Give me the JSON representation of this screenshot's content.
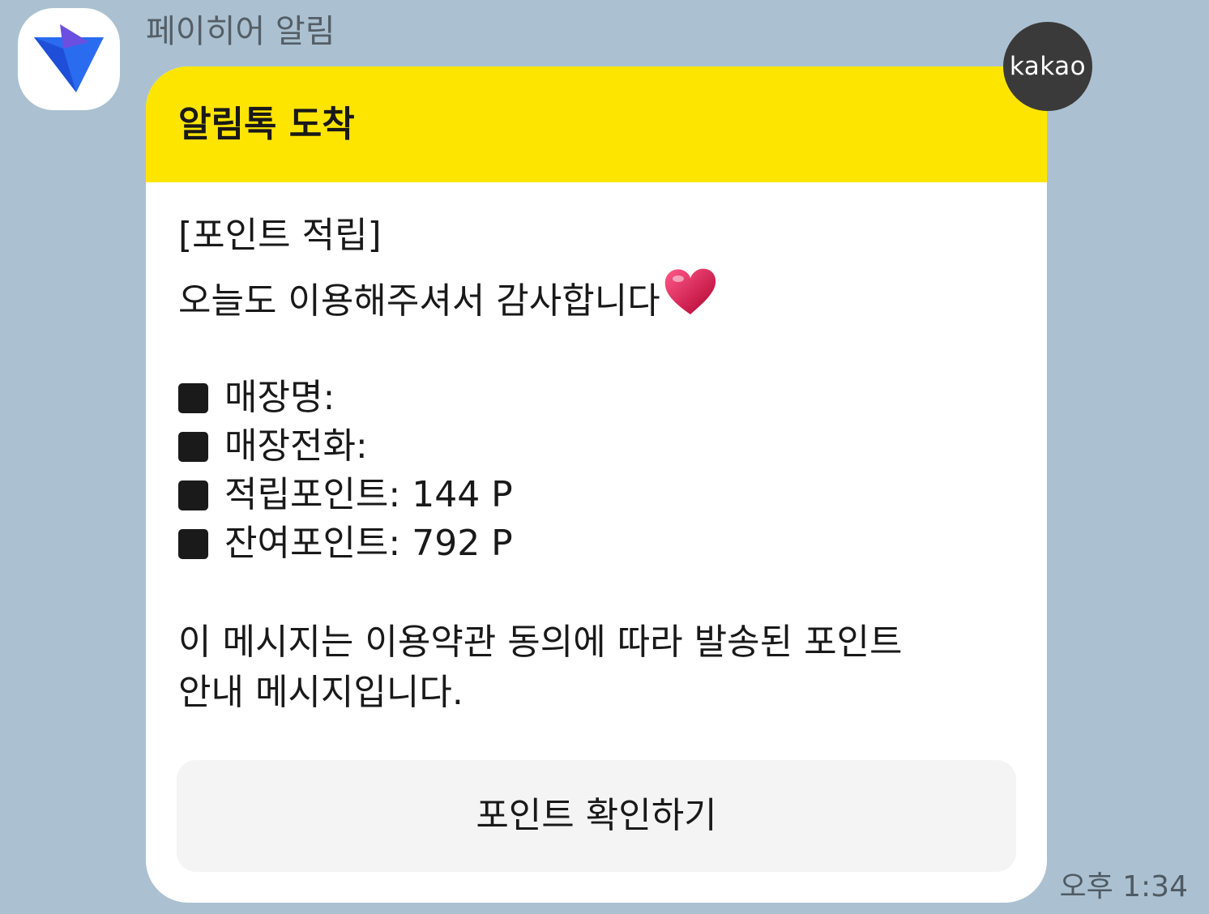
{
  "sender": {
    "name": "페이히어 알림",
    "avatar_icon": "payhere-logo-icon"
  },
  "message": {
    "header_title": "알림톡 도착",
    "badge": "kakao",
    "title_line": "[포인트 적립]",
    "greeting": "오늘도 이용해주셔서 감사합니다",
    "greeting_emoji": "heart-icon",
    "details": [
      {
        "label": "매장명:"
      },
      {
        "label": "매장전화:"
      },
      {
        "label": "적립포인트: 144 P"
      },
      {
        "label": "잔여포인트: 792 P"
      }
    ],
    "notice_lines": [
      "이 메시지는 이용약관 동의에 따라 발송된 포인트",
      "안내 메시지입니다."
    ],
    "button_label": "포인트 확인하기",
    "timestamp": "오후 1:34"
  },
  "colors": {
    "chat_background": "#abc1d1",
    "header_yellow": "#fee500",
    "badge_dark": "#3a3a3a",
    "button_gray": "#f4f4f4",
    "logo_blue": "#2a6cf0",
    "logo_purple": "#6b4fe0"
  }
}
